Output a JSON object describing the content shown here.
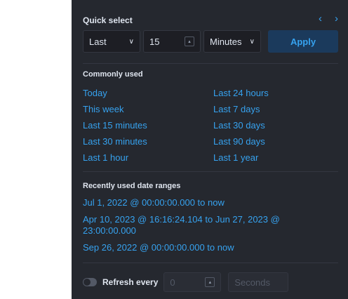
{
  "quick_select": {
    "title": "Quick select",
    "prev_icon": "chevron-left-icon",
    "next_icon": "chevron-right-icon",
    "direction_value": "Last",
    "amount_value": "15",
    "unit_value": "Minutes",
    "apply_label": "Apply"
  },
  "commonly_used": {
    "title": "Commonly used",
    "items": [
      "Today",
      "Last 24 hours",
      "This week",
      "Last 7 days",
      "Last 15 minutes",
      "Last 30 days",
      "Last 30 minutes",
      "Last 90 days",
      "Last 1 hour",
      "Last 1 year"
    ]
  },
  "recently_used": {
    "title": "Recently used date ranges",
    "items": [
      "Jul 1, 2022 @ 00:00:00.000 to now",
      "Apr 10, 2023 @ 16:16:24.104 to Jun 27, 2023 @ 23:00:00.000",
      "Sep 26, 2022 @ 00:00:00.000 to now"
    ]
  },
  "refresh": {
    "label": "Refresh every",
    "interval_value": "0",
    "unit_placeholder": "Seconds"
  },
  "trigger": {
    "icon": "calendar-icon",
    "dropdown_icon": "chevron-down-icon"
  },
  "colors": {
    "panel_bg": "#25282f",
    "link": "#36a2ef",
    "text": "#dfe5ef",
    "apply_bg": "#1b3a5c"
  }
}
